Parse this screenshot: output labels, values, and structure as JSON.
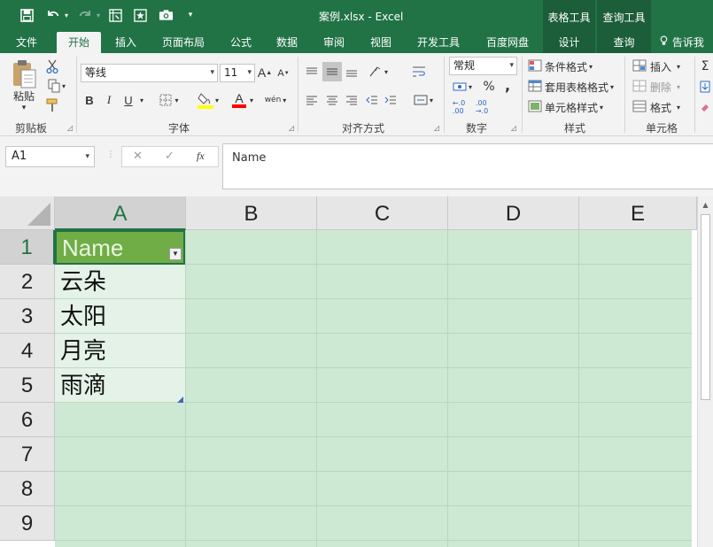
{
  "window": {
    "title": "案例.xlsx - Excel",
    "context_tools": [
      "表格工具",
      "查询工具"
    ]
  },
  "quick_access": {
    "icons": [
      "save-icon",
      "undo-icon",
      "redo-icon",
      "pivot-icon",
      "star-icon",
      "camera-icon",
      "customize-icon"
    ]
  },
  "tabs": [
    {
      "label": "文件",
      "active": false
    },
    {
      "label": "开始",
      "active": true
    },
    {
      "label": "插入",
      "active": false
    },
    {
      "label": "页面布局",
      "active": false
    },
    {
      "label": "公式",
      "active": false
    },
    {
      "label": "数据",
      "active": false
    },
    {
      "label": "审阅",
      "active": false
    },
    {
      "label": "视图",
      "active": false
    },
    {
      "label": "开发工具",
      "active": false
    },
    {
      "label": "百度网盘",
      "active": false
    },
    {
      "label": "设计",
      "active": false
    },
    {
      "label": "查询",
      "active": false
    }
  ],
  "tell_me": "告诉我",
  "ribbon": {
    "clipboard": {
      "label": "剪贴板",
      "paste": "粘贴"
    },
    "font": {
      "label": "字体",
      "name": "等线",
      "size": "11",
      "bold": "B",
      "italic": "I",
      "underline": "U",
      "grow": "A",
      "shrink": "A",
      "font_color": "A",
      "phonetic": "wén"
    },
    "alignment": {
      "label": "对齐方式"
    },
    "number": {
      "label": "数字",
      "format": "常规",
      "percent": "%",
      "comma": ","
    },
    "styles": {
      "label": "样式",
      "conditional": "条件格式",
      "table_style": "套用表格格式",
      "cell_style": "单元格样式"
    },
    "cells": {
      "label": "单元格",
      "insert": "插入",
      "delete": "删除",
      "format": "格式"
    }
  },
  "formula_bar": {
    "name_box": "A1",
    "cancel": "✕",
    "enter": "✓",
    "fx": "fx",
    "value": "Name"
  },
  "grid": {
    "columns": [
      "A",
      "B",
      "C",
      "D",
      "E"
    ],
    "rows": [
      "1",
      "2",
      "3",
      "4",
      "5",
      "6",
      "7",
      "8",
      "9"
    ],
    "selected_cell": "A1",
    "header_cell": "Name",
    "values": [
      "云朵",
      "太阳",
      "月亮",
      "雨滴"
    ],
    "colors": {
      "table_header": "#70ad47",
      "table_body": "#e4f2e7",
      "sheet_tint": "#cde8d3",
      "accent": "#217346"
    }
  }
}
